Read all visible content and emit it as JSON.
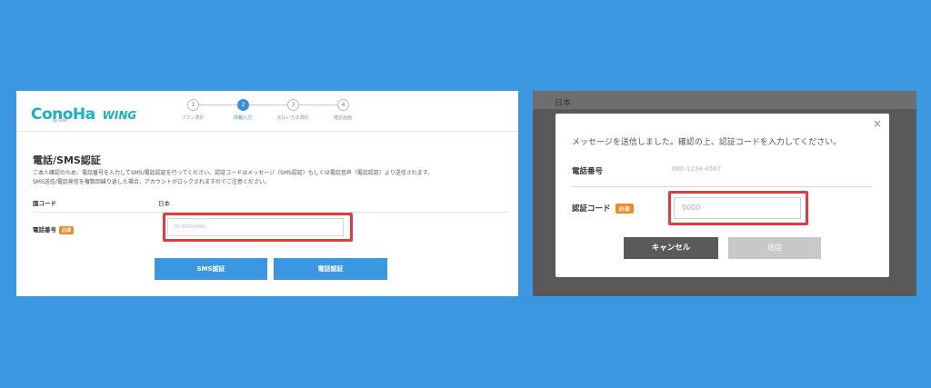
{
  "left": {
    "logo": {
      "main": "ConoHa",
      "sub": "by GMO",
      "wing": "WING"
    },
    "steps": [
      {
        "number": "1",
        "label": "プラン選択",
        "active": false
      },
      {
        "number": "2",
        "label": "情報入力",
        "active": true
      },
      {
        "number": "3",
        "label": "支払い方法選択",
        "active": false
      },
      {
        "number": "4",
        "label": "確認画面",
        "active": false
      }
    ],
    "title": "電話/SMS認証",
    "description_lines": [
      "ご本人確認のため、電話番号を入力してSMS/電話認証を行ってください。認証コードはメッセージ（SMS認証）もしくは電話音声（電話認証）より送信されます。",
      "SMS送信/電話発信を複数回繰り返した場合、アカウントがロックされますのでご注意ください。"
    ],
    "country_label": "国コード",
    "country_value": "日本",
    "phone_label": "電話番号",
    "required_badge": "必須",
    "phone_placeholder": "00-0000-0000",
    "sms_button": "SMS認証",
    "call_button": "電話認証"
  },
  "right": {
    "background_text": "日本",
    "close_glyph": "×",
    "message": "メッセージを送信しました。確認の上、認証コードを入力してください。",
    "phone_label": "電話番号",
    "phone_value": "080-1234-4567",
    "code_label": "認証コード",
    "required_badge": "必須",
    "code_placeholder": "0000",
    "cancel_button": "キャンセル",
    "send_button": "送信"
  },
  "colors": {
    "page_background": "#3a97e0",
    "brand": "#18b0c6",
    "primary_button": "#3a97e0",
    "badge": "#f08a24",
    "highlight": "#e23b3b"
  }
}
